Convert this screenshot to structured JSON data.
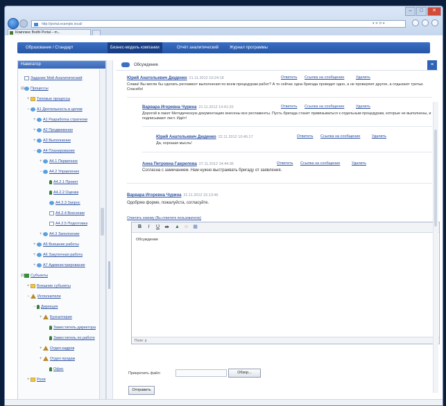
{
  "browser": {
    "address": "http://portal.example.local/",
    "tab_title": "Комплекс Bodhi Portal – m...",
    "addr_tools": "▾ ✕ ⟳ ▾",
    "win_controls": [
      "–",
      "□",
      "✕"
    ]
  },
  "menu": {
    "items": [
      "Образование / Стандарт",
      "Бизнес-модель компании",
      "Отчёт аналитический",
      "Журнал программы"
    ],
    "active_index": 1
  },
  "sidebar": {
    "header": "Навигатор",
    "nodes": [
      {
        "label": "Задание Мой Аналитический",
        "indent": 0,
        "icon": "doc",
        "toggle": ""
      },
      {
        "label": "Процессы",
        "indent": 0,
        "icon": "flow",
        "toggle": "⊟"
      },
      {
        "label": "Типовые процессы",
        "indent": 1,
        "icon": "folder",
        "toggle": "+"
      },
      {
        "label": "А1 Деятельность в целом",
        "indent": 1,
        "icon": "flow",
        "toggle": "−"
      },
      {
        "label": "А1 Разработка стратегии",
        "indent": 2,
        "icon": "flow",
        "toggle": "+"
      },
      {
        "label": "А2 Продвижение",
        "indent": 2,
        "icon": "flow",
        "toggle": "+"
      },
      {
        "label": "А3 Выполнение",
        "indent": 2,
        "icon": "flow",
        "toggle": "+"
      },
      {
        "label": "А4 Планирование",
        "indent": 2,
        "icon": "flow",
        "toggle": "−"
      },
      {
        "label": "А4.1 Первичное",
        "indent": 3,
        "icon": "flow",
        "toggle": "+"
      },
      {
        "label": "А4.2 Управление",
        "indent": 3,
        "icon": "flow",
        "toggle": "−"
      },
      {
        "label": "А4.2.1 Проект",
        "indent": 4,
        "icon": "person",
        "toggle": ""
      },
      {
        "label": "А4.2.2 Оценка",
        "indent": 4,
        "icon": "person",
        "toggle": ""
      },
      {
        "label": "А4.2.3 Запрос",
        "indent": 4,
        "icon": "flow",
        "toggle": ""
      },
      {
        "label": "А4.2.4 Внесение",
        "indent": 4,
        "icon": "doc",
        "toggle": ""
      },
      {
        "label": "А4.2.5 Подготовка",
        "indent": 4,
        "icon": "doc",
        "toggle": ""
      },
      {
        "label": "А4.3 Заполнение",
        "indent": 3,
        "icon": "flow",
        "toggle": "+"
      },
      {
        "label": "А5 Внешние работы",
        "indent": 2,
        "icon": "flow",
        "toggle": "+"
      },
      {
        "label": "А6 Закупочная работа",
        "indent": 2,
        "icon": "flow",
        "toggle": "+"
      },
      {
        "label": "А7 Администрирование",
        "indent": 2,
        "icon": "flow",
        "toggle": "+"
      },
      {
        "label": "Субъекты",
        "indent": 0,
        "icon": "box",
        "toggle": "⊟"
      },
      {
        "label": "Внешние субъекты",
        "indent": 1,
        "icon": "folder",
        "toggle": "+"
      },
      {
        "label": "Исполнители",
        "indent": 1,
        "icon": "tri",
        "toggle": "−"
      },
      {
        "label": "Дирекция",
        "indent": 2,
        "icon": "person",
        "toggle": "−"
      },
      {
        "label": "Бухгалтерия",
        "indent": 3,
        "icon": "tri",
        "toggle": "+"
      },
      {
        "label": "Заместитель директора",
        "indent": 4,
        "icon": "person",
        "toggle": ""
      },
      {
        "label": "Заместитель по работе",
        "indent": 4,
        "icon": "person",
        "toggle": ""
      },
      {
        "label": "Отдел кадров",
        "indent": 3,
        "icon": "tri",
        "toggle": "+"
      },
      {
        "label": "Отдел продаж",
        "indent": 3,
        "icon": "tri",
        "toggle": "+"
      },
      {
        "label": "Офис",
        "indent": 4,
        "icon": "person",
        "toggle": ""
      },
      {
        "label": "Роли",
        "indent": 1,
        "icon": "folder",
        "toggle": "+"
      }
    ]
  },
  "main": {
    "title": "Обсуждение",
    "comments": [
      {
        "author": "Юрий Анатольевич Дюденко",
        "date": "21.11.2012 10:24:18",
        "actions": [
          "Ответить",
          "Ссылка на сообщение",
          "Удалить"
        ],
        "text": "Слава! Вы могли бы сделать регламент выполнения по всем процедурам работ? А то сейчас одна бригада проводит одно, а не проверяют другое, а отдыхают третьи. Спасибо!"
      },
      {
        "author": "Варвара Игоревна Чурина",
        "date": "21.11.2012 14:41:20",
        "actions": [
          "Ответить",
          "Ссылка на сообщение",
          "Удалить"
        ],
        "text": "Дорогой в пакет Методическую документацию внесены все регламенты. Пусть бригада станет привязываться к отдельным процедурам, которые не выполнены, и подписывают лист. Идёт!"
      },
      {
        "author": "Юрий Анатольевич Дюденко",
        "date": "22.11.2012 10:45:17",
        "actions": [
          "Ответить",
          "Ссылка на сообщение",
          "Удалить"
        ],
        "text": "Да, хорошая мысль!"
      },
      {
        "author": "Анна Петровна Гаврилова",
        "date": "27.11.2012 14:44:36",
        "actions": [
          "Ответить",
          "Ссылка на сообщение",
          "Удалить"
        ],
        "text": "Согласна с замечанием. Нам нужно выстраивать бригаду от заявления."
      },
      {
        "author": "Варвара Игоревна Чурина",
        "date": "21.11.2012 15:13:46",
        "actions": [],
        "text": "Одобряю форме, пожалуйста, согласуйте."
      }
    ],
    "reply_link": "Ответить новому (Вы ответите пользователю)",
    "editor": {
      "toolbar": [
        "B",
        "I",
        "U",
        "ab",
        "▲",
        "☺",
        "▦"
      ],
      "body": "Обсуждение",
      "status": "Поле: р"
    },
    "attach_label": "Прикрепить файл:",
    "browse_label": "Обзор...",
    "send_label": "Отправить"
  }
}
